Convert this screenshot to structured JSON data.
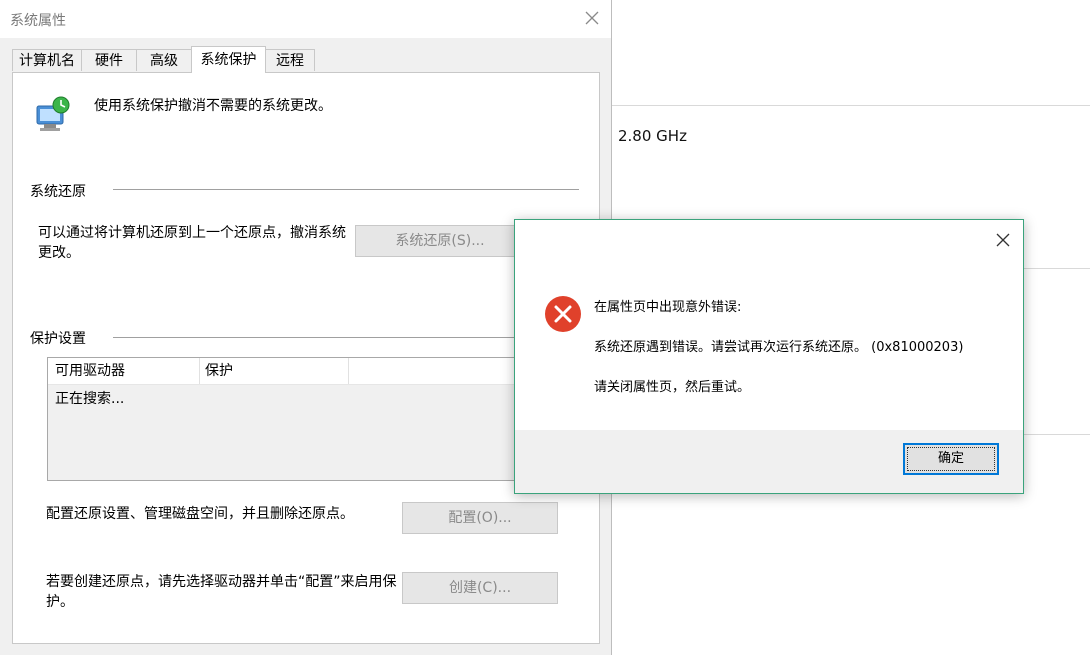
{
  "background": {
    "cpu_speed": "2.80 GHz"
  },
  "window": {
    "title": "系统属性",
    "tabs": [
      {
        "label": "计算机名"
      },
      {
        "label": "硬件"
      },
      {
        "label": "高级"
      },
      {
        "label": "系统保护",
        "active": true
      },
      {
        "label": "远程"
      }
    ],
    "description": "使用系统保护撤消不需要的系统更改。",
    "system_restore": {
      "group_title": "系统还原",
      "text": "可以通过将计算机还原到上一个还原点，撤消系统更改。",
      "button": "系统还原(S)..."
    },
    "protection": {
      "group_title": "保护设置",
      "columns": [
        "可用驱动器",
        "保护"
      ],
      "status": "正在搜索...",
      "config_text": "配置还原设置、管理磁盘空间，并且删除还原点。",
      "config_button": "配置(O)...",
      "create_text": "若要创建还原点，请先选择驱动器并单击“配置”来启用保护。",
      "create_button": "创建(C)..."
    }
  },
  "dialog": {
    "line1": "在属性页中出现意外错误:",
    "line2": "系统还原遇到错误。请尝试再次运行系统还原。 (0x81000203)",
    "line3": "请关闭属性页，然后重试。",
    "ok_button": "确定"
  },
  "colors": {
    "dialog_border": "#3aa37c",
    "error_icon": "#e0412b",
    "focus_border": "#0078d7"
  }
}
